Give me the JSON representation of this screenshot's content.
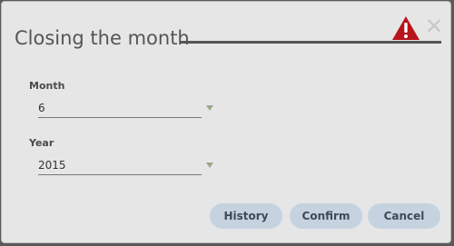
{
  "dialog": {
    "title": "Closing the month",
    "close_glyph": "✕",
    "icons": {
      "warning": "warning-triangle-icon",
      "close": "close-icon",
      "dropdown": "chevron-down-icon"
    }
  },
  "form": {
    "month": {
      "label": "Month",
      "value": "6"
    },
    "year": {
      "label": "Year",
      "value": "2015"
    }
  },
  "buttons": {
    "history": "History",
    "confirm": "Confirm",
    "cancel": "Cancel"
  },
  "colors": {
    "warning": "#b8141b",
    "button_bg": "#c5d3e0",
    "dialog_bg": "#e6e6e6"
  }
}
